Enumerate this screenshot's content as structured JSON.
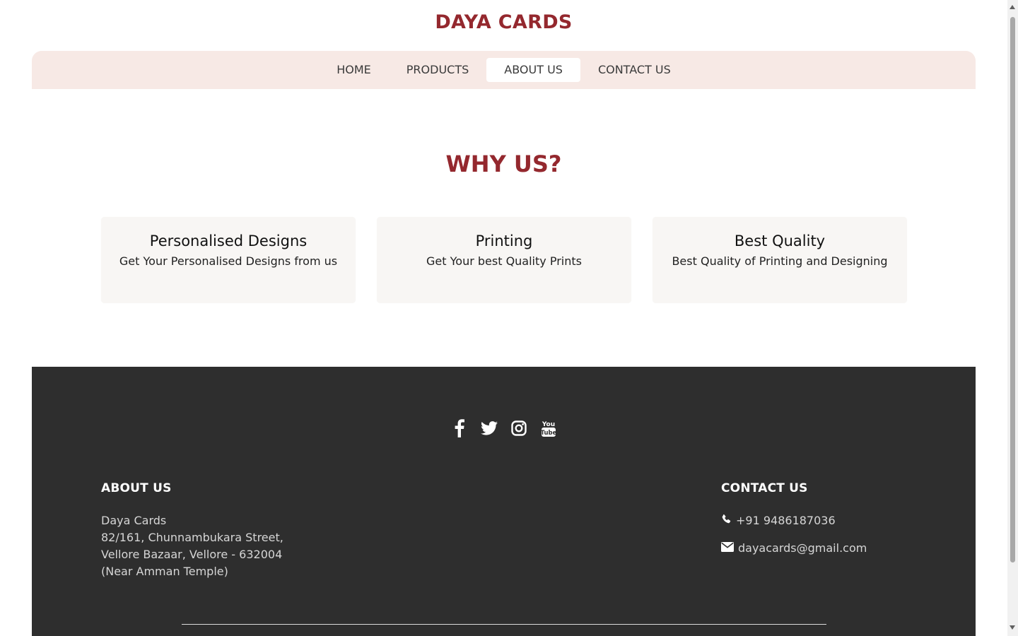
{
  "header": {
    "brand": "DAYA CARDS"
  },
  "nav": {
    "items": [
      {
        "label": "HOME"
      },
      {
        "label": "PRODUCTS"
      },
      {
        "label": "ABOUT US",
        "active": true
      },
      {
        "label": "CONTACT US"
      }
    ]
  },
  "why": {
    "title": "WHY US?",
    "cards": [
      {
        "title": "Personalised Designs",
        "desc": "Get Your Personalised Designs from us"
      },
      {
        "title": "Printing",
        "desc": "Get Your best Quality Prints"
      },
      {
        "title": "Best Quality",
        "desc": "Best Quality of Printing and Designing"
      }
    ]
  },
  "footer": {
    "social": [
      "facebook-icon",
      "twitter-icon",
      "instagram-icon",
      "youtube-icon"
    ],
    "about": {
      "heading": "ABOUT US",
      "lines": [
        "Daya Cards",
        "82/161, Chunnambukara Street,",
        "Vellore Bazaar, Vellore - 632004",
        "(Near Amman Temple)"
      ]
    },
    "contact": {
      "heading": "CONTACT US",
      "phone": "+91 9486187036",
      "email": "dayacards@gmail.com"
    }
  },
  "colors": {
    "brand": "#94282e",
    "nav_bg": "#f7e9e5",
    "card_bg": "#f8f6f4",
    "footer_bg": "#2e2e2e"
  }
}
